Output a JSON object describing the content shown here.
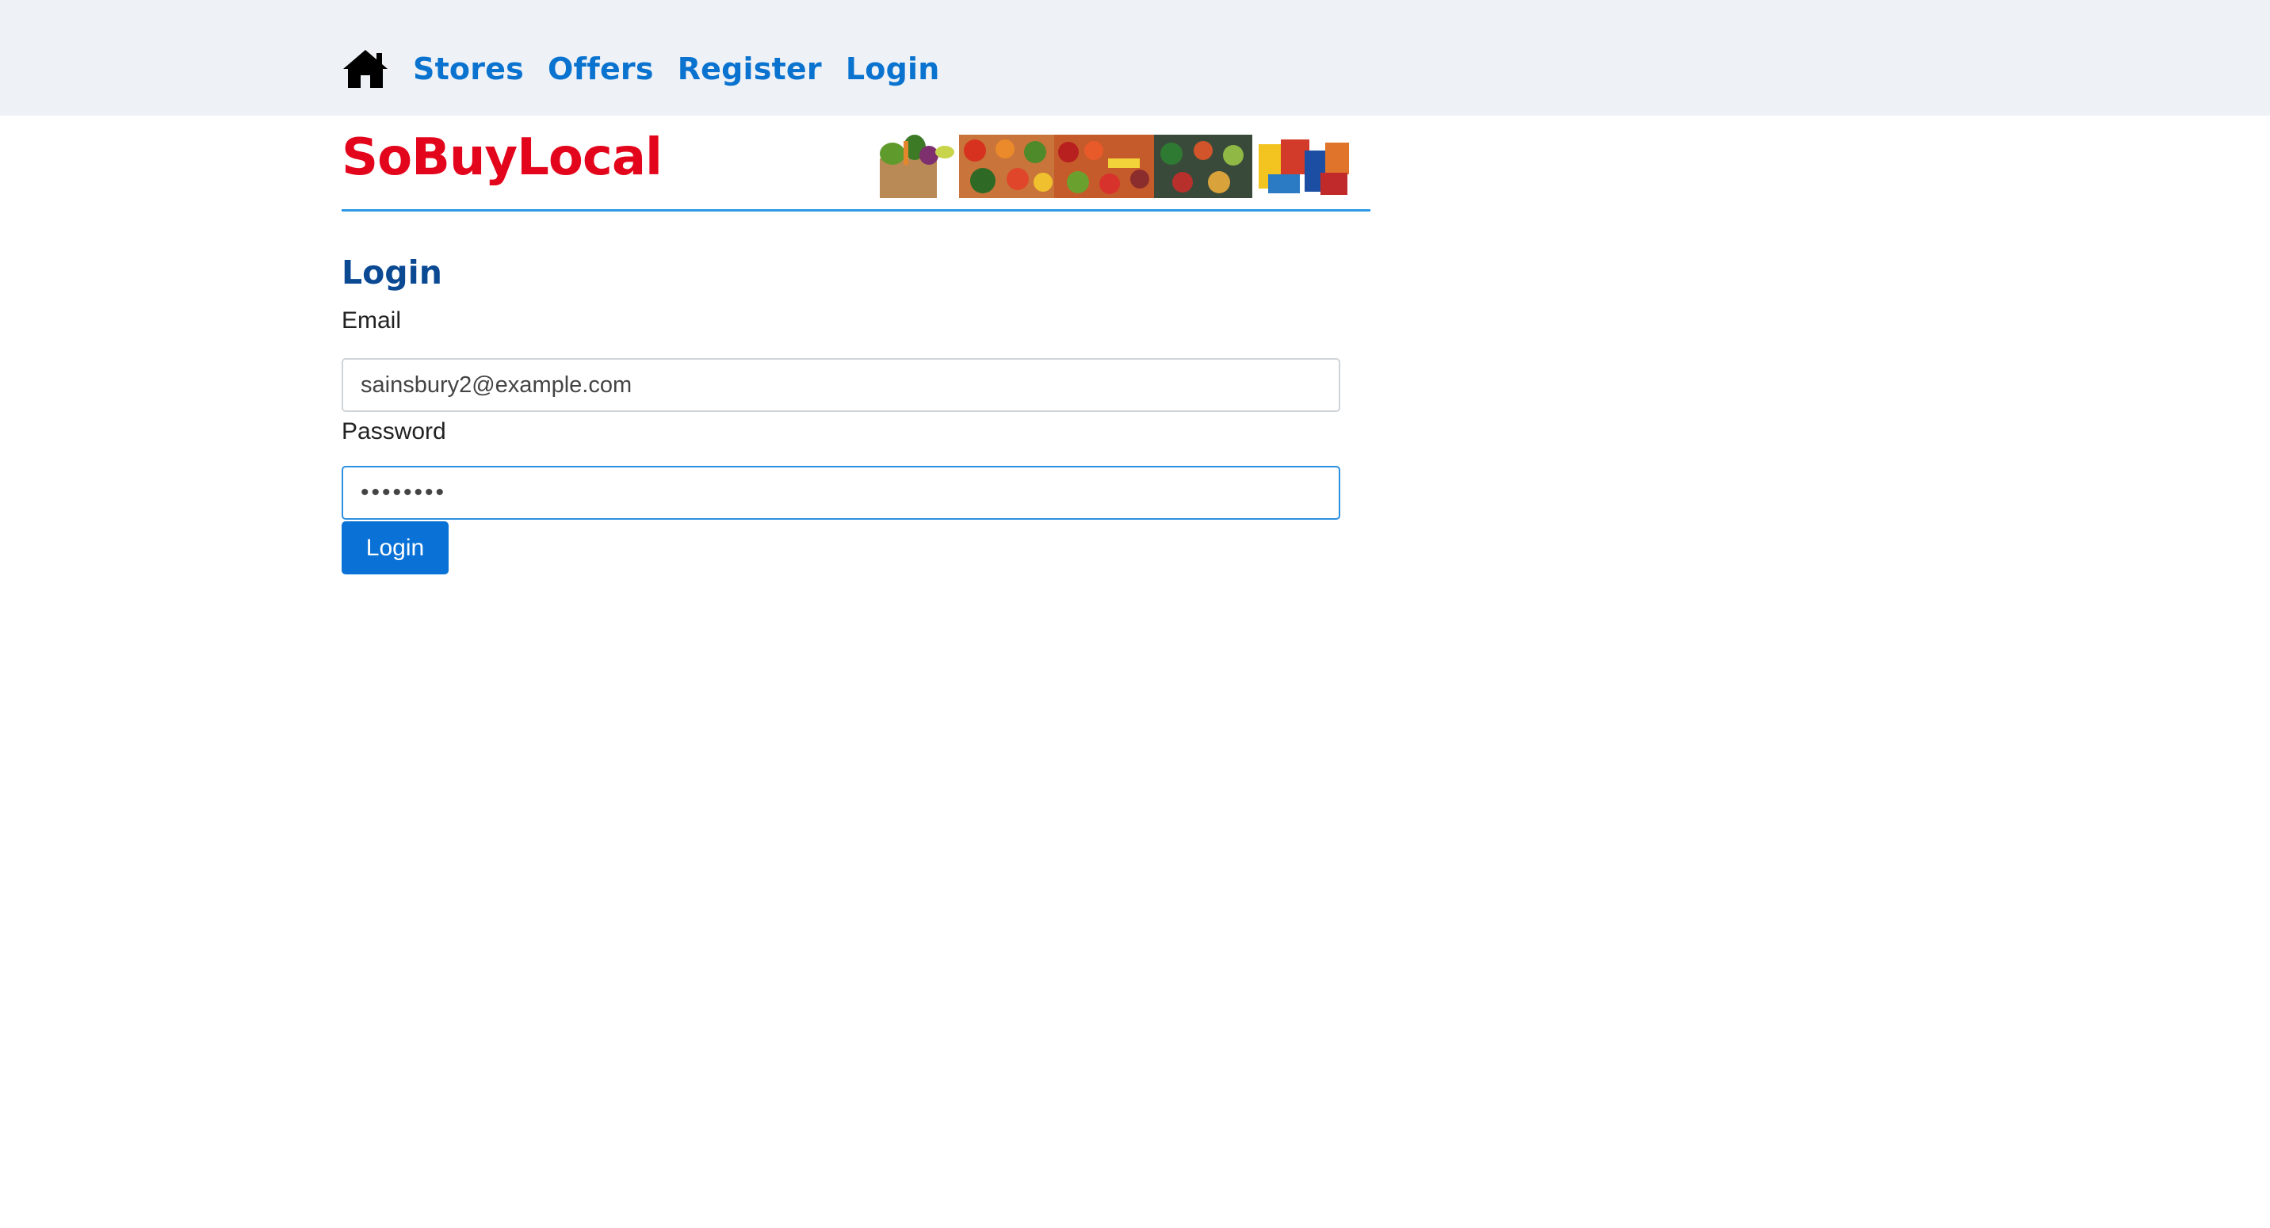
{
  "nav": {
    "home_icon": "home-icon",
    "items": [
      {
        "label": "Stores"
      },
      {
        "label": "Offers"
      },
      {
        "label": "Register"
      },
      {
        "label": "Login"
      }
    ]
  },
  "brand": {
    "name": "SoBuyLocal",
    "banner_image": "grocery-banner-image"
  },
  "page": {
    "title": "Login"
  },
  "form": {
    "email_label": "Email",
    "email_value": "sainsbury2@example.com",
    "password_label": "Password",
    "password_value": "••••••••",
    "submit_label": "Login"
  },
  "colors": {
    "nav_bg": "#eef2f7",
    "nav_link": "#0a72cf",
    "brand": "#e3051b",
    "title": "#0b4a93",
    "button": "#0a72d6",
    "divider": "#2d9ae3"
  }
}
